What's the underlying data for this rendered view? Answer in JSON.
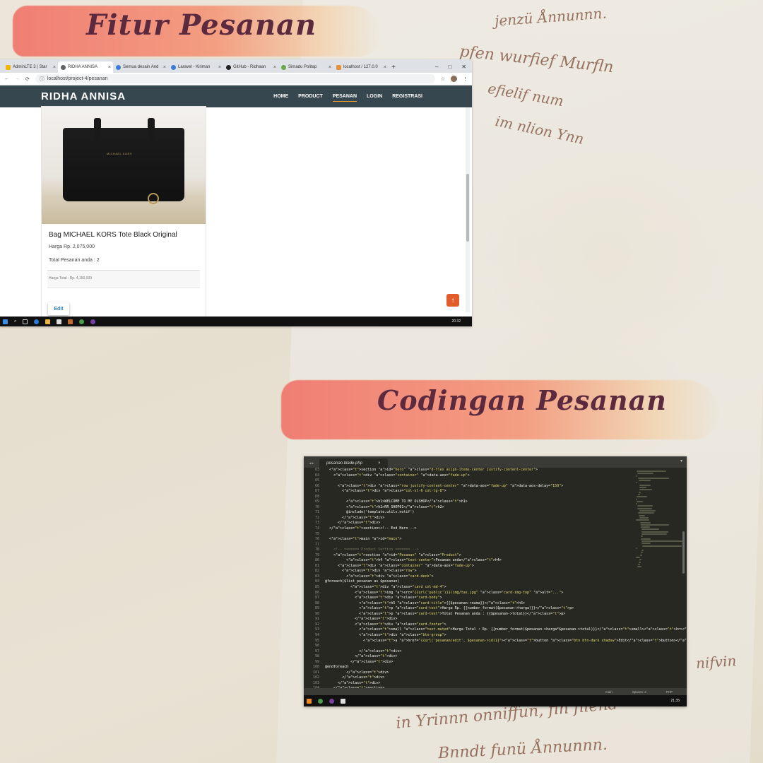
{
  "headings": {
    "top": "Fitur Pesanan",
    "bottom": "Codingan Pesanan"
  },
  "browser": {
    "tabs": [
      {
        "label": "AdminLTE 3 | Star",
        "favicon_color": "#f4b400"
      },
      {
        "label": "RIDHA ANNISA",
        "favicon_color": "#5f6368"
      },
      {
        "label": "Semua desain And",
        "favicon_color": "#3b7dd8"
      },
      {
        "label": "Laravel - Kiriman",
        "favicon_color": "#3b7dd8"
      },
      {
        "label": "GitHub - Ridhaan",
        "favicon_color": "#222222"
      },
      {
        "label": "Simadu Politap",
        "favicon_color": "#6aa84f"
      },
      {
        "label": "localhost / 127.0.0",
        "favicon_color": "#e69138"
      }
    ],
    "active_tab_index": 1,
    "url": "localhost/project-4/pesanan",
    "site": {
      "brand": "RIDHA ANNISA",
      "nav": [
        "HOME",
        "PRODUCT",
        "PESANAN",
        "LOGIN",
        "REGISTRASI"
      ],
      "active_nav": "PESANAN"
    },
    "product": {
      "image_logo": "MICHAEL KORS",
      "title": "Bag MICHAEL KORS Tote Black Original",
      "price": "Harga Rp. 2,075,000",
      "total_orders": "Total Pesanan anda : 2",
      "footer_total": "Harga Total : Rp. 4,150,000",
      "edit_label": "Edit"
    },
    "taskbar_time": "20.32"
  },
  "editor": {
    "file_tab": "pesanan.blade.php",
    "line_numbers": [
      "63",
      "64",
      "65",
      "66",
      "67",
      "68",
      "69",
      "70",
      "71",
      "72",
      "73",
      "74",
      "75",
      "76",
      "77",
      "78",
      "79",
      "80",
      "81",
      "82",
      "83",
      "84",
      "85",
      "86",
      "87",
      "88",
      "89",
      "90",
      "91",
      "92",
      "93",
      "94",
      "95",
      "96",
      "97",
      "98",
      "99",
      "100",
      "101",
      "102",
      "103",
      "104"
    ],
    "code_lines": [
      "  <section id=\"hero\" class=\"d-flex align-items-center justify-content-center\">",
      "    <div class=\"container\" data-aos=\"fade-up\">",
      "",
      "      <div class=\"row justify-content-center\" data-aos=\"fade-up\" data-aos-delay=\"150\">",
      "        <div class=\"col-xl-6 col-lg-8\">",
      "",
      "          <h1>WELCOME TO MY OLSHOP</h1>",
      "          <h2>RR_SHOP01</h2>",
      "          @include('template.utils.notif')",
      "        </div>",
      "      </div>",
      "  </section><!-- End Hero -->",
      "",
      "  <main id=\"main\">",
      "",
      "    <!-- ======= Product Section ======= -->",
      "    <section id=\"Pesanan\" class=\"Product\">",
      "          <h4 class=\"text-center\">Pesanan anda</h4>",
      "      <div class=\"container\" data-aos=\"fade-up\">",
      "        <div class=\"row\">",
      "          <div class=\"card-deck\">",
      "@foreach($list_pesanan as $pesanan)",
      "            <div class=\"card col-md-4\">",
      "              <img src=\"{{url('public')}}/img/tas.jpg\" class=\"card-img-top\" alt=\"...\">",
      "              <div class=\"card-body\">",
      "                <h5 class=\"card-title\">{{$pesanan->nama}}</h5>",
      "                <p class=\"card-text\">Harga Rp. {{number_format($pesanan->harga)}}</p>",
      "                <p class=\"card-text\">Total Pesanan anda : {{$pesanan->total}}</p>",
      "              </div>",
      "              <div class=\"card-footer\">",
      "                <small class=\"text-muted\">Harga Total : Rp. {{number_format($pesanan->harga*$pesanan->total)}}</small><hr><br>",
      "                <div class=\"btn-group\">",
      "                  <a href=\"{{url('pesanan/edit', $pesanan->id)}}\"><button class=\"btn btn-dark shadow\">Edit</button></a>",
      "",
      "                </div>",
      "              </div>",
      "            </div>",
      "@endforeach",
      "          </div>",
      "        </div>",
      "      </div>",
      "    </section>"
    ],
    "status": {
      "branch": "main",
      "spaces": "Spaces: 2",
      "syntax": "PHP"
    },
    "taskbar_time": "21.35"
  },
  "background_script": [
    "jenzü Ånnunnn.",
    "pfen wurfief Murfln",
    "efielif num",
    "im nlion Ynn",
    "in Yrinnn onniffun, fin filend",
    "nifvin",
    "Bnndt funü Ånnunnn."
  ],
  "colors": {
    "nav_bg": "#37474f",
    "accent": "#f0a030",
    "heading": "#5b2a3f",
    "editor_bg": "#272822",
    "scroll_top": "#e25b2a"
  }
}
